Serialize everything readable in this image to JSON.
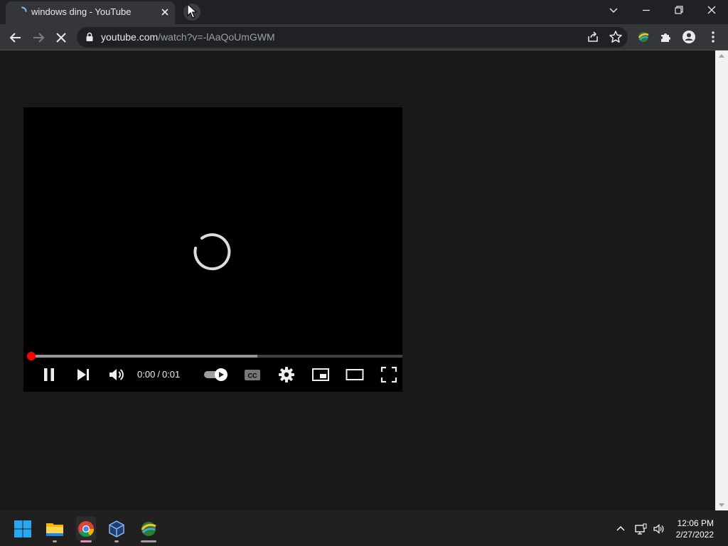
{
  "browser": {
    "tab_title": "windows ding - YouTube",
    "url_host": "youtube.com",
    "url_path": "/watch?v=-lAaQoUmGWM"
  },
  "player": {
    "current_time": "0:00",
    "duration": "0:01",
    "time_separator": "/",
    "played_fraction": 0.0,
    "buffered_fraction": 0.61,
    "state": "loading",
    "autoplay": "on"
  },
  "taskbar": {
    "clock_time": "12:06 PM",
    "clock_date": "2/27/2022",
    "apps": [
      "windows-start",
      "file-explorer",
      "google-chrome",
      "virtualbox",
      "internet-download-manager"
    ]
  },
  "colors": {
    "accent": "#ff0000",
    "page_background": "#181818",
    "tab_active": "#35363a"
  }
}
